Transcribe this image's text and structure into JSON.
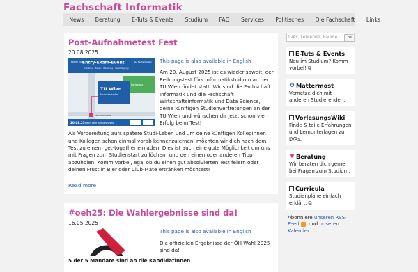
{
  "site": {
    "title": "Fachschaft Informatik"
  },
  "nav": {
    "items": [
      "News",
      "Beratung",
      "E-Tuts & Events",
      "Studium",
      "FAQ",
      "Fachschaft",
      "Services",
      "Politisches",
      "Die Fachschaft",
      "Links"
    ]
  },
  "posts": [
    {
      "title": "Post-Aufnahmetest Fest",
      "date": "20.08.2025",
      "lang_link": "This page is also available in English",
      "paragraphs": [
        "Am 20. August 2025 ist es wieder soweit: der Reihungstest fürs Informatikstudium an der TU Wien findet statt. Wir sind die Fachschaft Informatik und die Fachschaft Wirtschaftsinformatik und Data Science, deine künftigen Studienvertretungen an der TU Wien und wünschen dir jetzt schon viel Erfolg beim Test!",
        "Als Vorbereitung aufs spätere Studi-Leben und um deine künftigen Kolleginnen und Kollegen schon einmal vorab kennenzulernen, möchten wir dich nach dem Test zu einem get-together einladen. Dies ist auch eine gute Möglichkeit um uns mit Fragen zum Studienstart zu löchern und den einen oder anderen Tipp abzuholen. Komm vorbei, egal ob du einen gut absolvierten Test feiern oder deinen Frust in Bier oder Club-Mate ertränken möchtest!"
      ],
      "read_more": "Read more",
      "poster": {
        "header_small": "Komm zum",
        "header_big": "Entry-Exam-Event",
        "header_small2": "der Fachschaften",
        "subtitle": "Getränke · Essen · Beratung · Verköstigung",
        "building": "TU Wien",
        "building_sub": "Favoritenstraße",
        "area": "Karlsplatz",
        "station": "Favoritenstraße",
        "footer_date": "20.08.25",
        "footer_text": "Nach dem Aufnahmetest"
      }
    },
    {
      "title": "#oeh25: Die Wahlergebnisse sind da!",
      "date": "16.05.2025",
      "lang_link": "This page is also available in English",
      "paragraphs": [
        "Die offiziellen Ergebnisse der ÖH-Wahl 2025 sind da!",
        "5 der 5 Mandate sind an die Kandidatinnen"
      ]
    }
  ],
  "sidebar": {
    "search_placeholder": "LVAs, Lehrende, Räume",
    "search_button": "Los",
    "widgets": [
      {
        "icon": "calendar-icon",
        "title": "E-Tuts & Events",
        "text": "Neu im Studium? Komm vorbei! ⧉"
      },
      {
        "icon": "power-icon",
        "title": "Mattermost",
        "text": "Vernetze dich mit anderen Studierenden."
      },
      {
        "icon": "book-icon",
        "title": "VorlesungsWiki",
        "text": "Finde & teile Erfahrungen und Lernunterlagen zu LVAs."
      },
      {
        "icon": "heart-icon",
        "title": "Beratung",
        "text": "Wir beraten dich gerne bei Fragen zum Studium."
      },
      {
        "icon": "document-icon",
        "title": "Curricula",
        "text": "Studienpläne einfach erklärt. ⧉"
      }
    ],
    "subscribe": {
      "prefix": "Abonniere",
      "rss": "unseren RSS-Feed",
      "and": "und",
      "calendar": "unseren Kalender"
    }
  },
  "colors": {
    "accent": "#c64a9c",
    "link": "#2a5db0",
    "poster_blue": "#1f5fa8",
    "poster_green": "#4fae5a"
  }
}
